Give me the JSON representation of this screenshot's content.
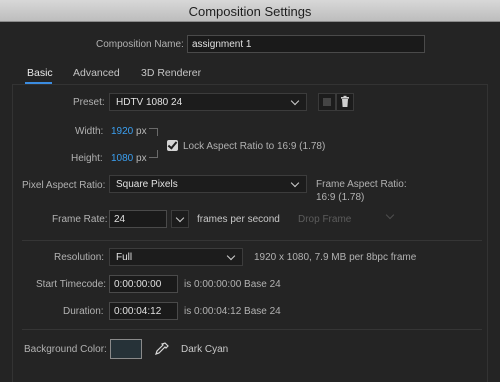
{
  "window": {
    "title": "Composition Settings"
  },
  "comp_name": {
    "label": "Composition Name:",
    "value": "assignment 1"
  },
  "tabs": [
    {
      "label": "Basic"
    },
    {
      "label": "Advanced"
    },
    {
      "label": "3D Renderer"
    }
  ],
  "preset": {
    "label": "Preset:",
    "value": "HDTV 1080 24"
  },
  "width": {
    "label": "Width:",
    "value": "1920",
    "unit": "px"
  },
  "height": {
    "label": "Height:",
    "value": "1080",
    "unit": "px"
  },
  "lock_aspect": {
    "label": "Lock Aspect Ratio to 16:9 (1.78)",
    "checked": true
  },
  "pixel_aspect": {
    "label": "Pixel Aspect Ratio:",
    "value": "Square Pixels",
    "frame_aspect_label": "Frame Aspect Ratio:",
    "frame_aspect_value": "16:9 (1.78)"
  },
  "frame_rate": {
    "label": "Frame Rate:",
    "value": "24",
    "unit": "frames per second",
    "drop_frame": "Drop Frame"
  },
  "resolution": {
    "label": "Resolution:",
    "value": "Full",
    "info": "1920 x 1080, 7.9 MB per 8bpc frame"
  },
  "start_timecode": {
    "label": "Start Timecode:",
    "value": "0:00:00:00",
    "info": "is 0:00:00:00  Base 24"
  },
  "duration": {
    "label": "Duration:",
    "value": "0:00:04:12",
    "info": "is 0:00:04:12  Base 24"
  },
  "background": {
    "label": "Background Color:",
    "name": "Dark Cyan",
    "color": "#263238"
  }
}
